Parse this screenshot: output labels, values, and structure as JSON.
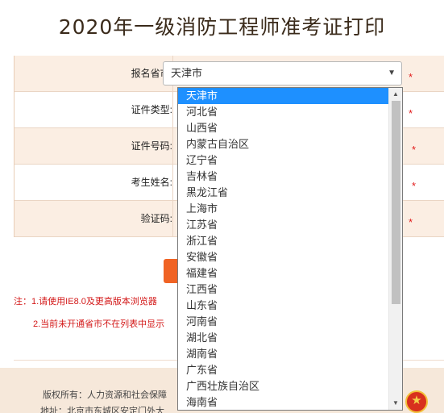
{
  "page_title": "2020年一级消防工程师准考证打印",
  "form": {
    "province_label": "报名省市:",
    "cert_type_label": "证件类型:",
    "cert_number_label": "证件号码:",
    "name_label": "考生姓名:",
    "captcha_label": "验证码:",
    "required_mark": "*",
    "province_value": "天津市",
    "select_arrow": "▼"
  },
  "notes": {
    "line1": "注：1.请使用IE8.0及更高版本浏览器",
    "line2": "2.当前未开通省市不在列表中显示"
  },
  "footer": {
    "copyright": "版权所有：人力资源和社会保障",
    "address": "地址：北京市东城区安定门外大"
  },
  "dropdown": {
    "options": [
      "天津市",
      "河北省",
      "山西省",
      "内蒙古自治区",
      "辽宁省",
      "吉林省",
      "黑龙江省",
      "上海市",
      "江苏省",
      "浙江省",
      "安徽省",
      "福建省",
      "江西省",
      "山东省",
      "河南省",
      "湖北省",
      "湖南省",
      "广东省",
      "广西壮族自治区",
      "海南省"
    ],
    "selected_index": 0,
    "scroll_up": "▲",
    "scroll_down": "▼"
  },
  "emblem_glyph": "★"
}
